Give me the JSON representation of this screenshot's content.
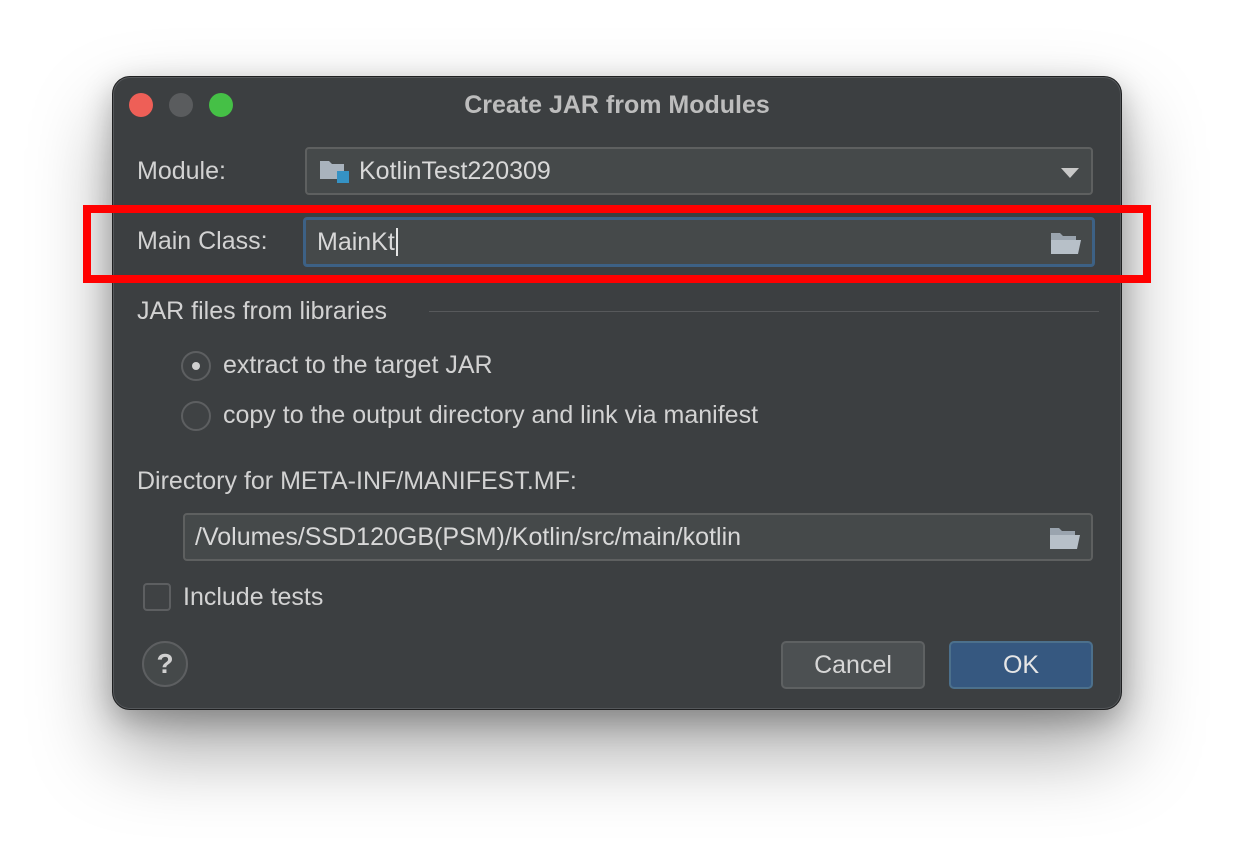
{
  "window": {
    "title": "Create JAR from Modules"
  },
  "module": {
    "label": "Module:",
    "value": "KotlinTest220309"
  },
  "main_class": {
    "label": "Main Class:",
    "value": "MainKt"
  },
  "libraries": {
    "section_label": "JAR files from libraries",
    "options": [
      {
        "label": "extract to the target JAR",
        "selected": true
      },
      {
        "label": "copy to the output directory and link via manifest",
        "selected": false
      }
    ]
  },
  "manifest": {
    "label": "Directory for META-INF/MANIFEST.MF:",
    "value": "/Volumes/SSD120GB(PSM)/Kotlin/src/main/kotlin"
  },
  "include_tests": {
    "label": "Include tests",
    "checked": false
  },
  "buttons": {
    "help": "?",
    "cancel": "Cancel",
    "ok": "OK"
  },
  "icons": {
    "module": "module-folder-icon",
    "browse": "folder-open-icon",
    "dropdown": "chevron-down-icon"
  },
  "colors": {
    "dialog_bg": "#3c3f41",
    "ok_button": "#365880",
    "focus_border": "#3d6185",
    "annotation": "#ff0000"
  }
}
